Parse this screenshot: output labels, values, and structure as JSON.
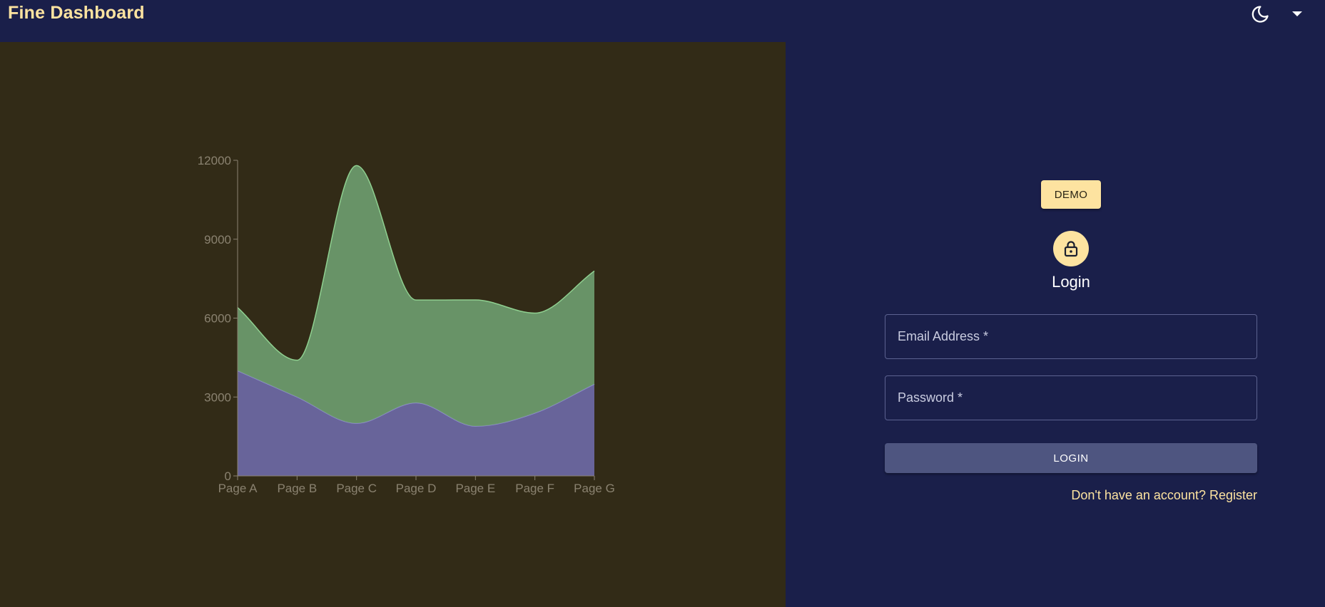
{
  "app": {
    "title": "Fine Dashboard"
  },
  "header": {
    "theme_toggle_icon": "moon-icon",
    "menu_icon": "caret-down-icon",
    "accent_color": "#fde3a0"
  },
  "login": {
    "demo_label": "DEMO",
    "avatar_icon": "lock-icon",
    "title": "Login",
    "email_placeholder": "Email Address *",
    "password_placeholder": "Password *",
    "submit_label": "LOGIN",
    "register_text": "Don't have an account? Register"
  },
  "chart_data": {
    "type": "area",
    "stacked": true,
    "curve": "smooth",
    "categories": [
      "Page A",
      "Page B",
      "Page C",
      "Page D",
      "Page E",
      "Page F",
      "Page G"
    ],
    "y_ticks": [
      0,
      3000,
      6000,
      9000,
      12000
    ],
    "ylim": [
      0,
      12000
    ],
    "series": [
      {
        "values": [
          4000,
          3000,
          2000,
          2780,
          1890,
          2390,
          3490
        ],
        "color": "#6e6aa8"
      },
      {
        "values": [
          2400,
          1398,
          9800,
          3908,
          4800,
          3800,
          4300
        ],
        "color": "#6e9f70"
      }
    ]
  }
}
